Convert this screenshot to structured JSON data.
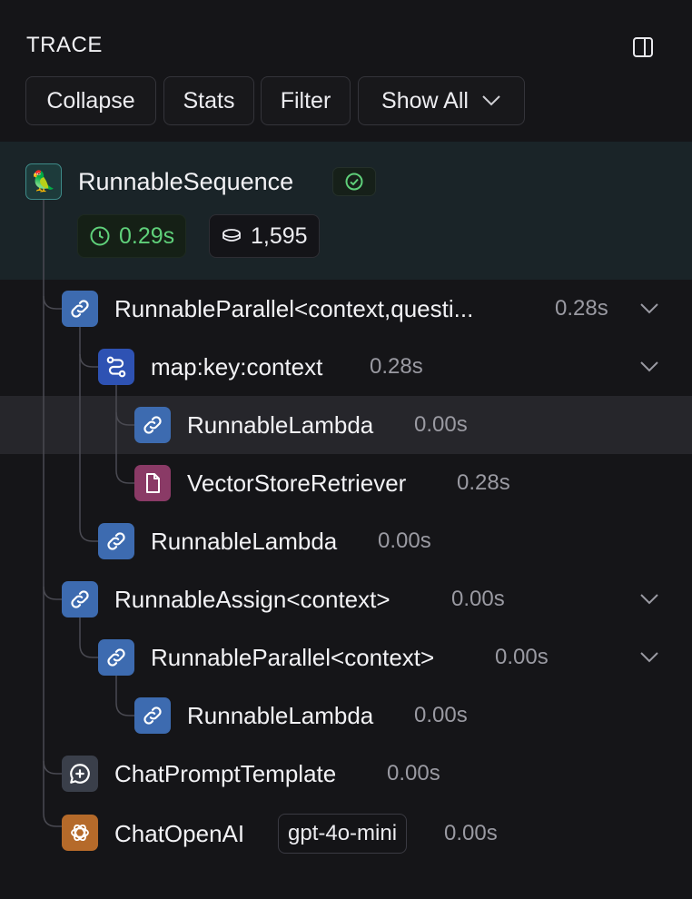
{
  "header": {
    "title": "TRACE",
    "panel_toggle_icon": "sidebar-panel-icon"
  },
  "toolbar": {
    "collapse_label": "Collapse",
    "stats_label": "Stats",
    "filter_label": "Filter",
    "show_all_label": "Show All"
  },
  "root": {
    "icon": "parrot-emoji-icon",
    "emoji": "🦜",
    "name": "RunnableSequence",
    "status": "success",
    "latency": "0.29s",
    "tokens": "1,595",
    "status_color": "#5fd07a"
  },
  "rows": [
    {
      "name": "RunnableParallel<context,questi...",
      "duration": "0.28s",
      "icon": "link-icon",
      "expandable": true
    },
    {
      "name": "map:key:context",
      "duration": "0.28s",
      "icon": "map-route-icon",
      "expandable": true
    },
    {
      "name": "RunnableLambda",
      "duration": "0.00s",
      "icon": "link-icon",
      "selected": true
    },
    {
      "name": "VectorStoreRetriever",
      "duration": "0.28s",
      "icon": "document-icon"
    },
    {
      "name": "RunnableLambda",
      "duration": "0.00s",
      "icon": "link-icon"
    },
    {
      "name": "RunnableAssign<context>",
      "duration": "0.00s",
      "icon": "link-icon",
      "expandable": true
    },
    {
      "name": "RunnableParallel<context>",
      "duration": "0.00s",
      "icon": "link-icon",
      "expandable": true
    },
    {
      "name": "RunnableLambda",
      "duration": "0.00s",
      "icon": "link-icon"
    },
    {
      "name": "ChatPromptTemplate",
      "duration": "0.00s",
      "icon": "chat-plus-icon"
    },
    {
      "name": "ChatOpenAI",
      "duration": "0.00s",
      "icon": "openai-icon",
      "model": "gpt-4o-mini"
    }
  ]
}
